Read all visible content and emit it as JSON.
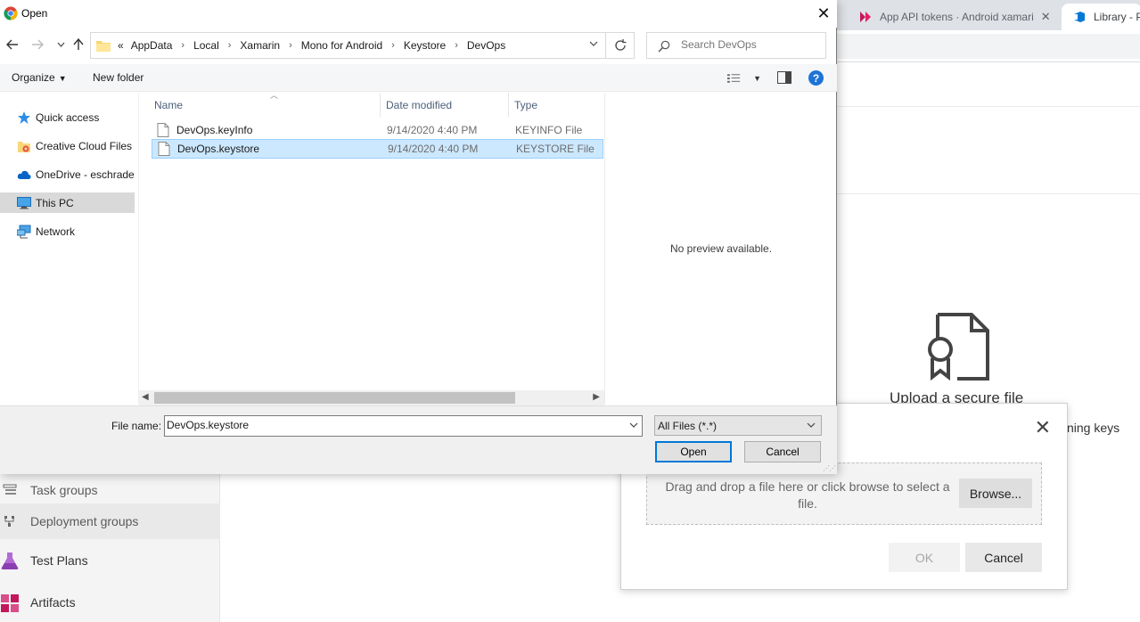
{
  "background": {
    "tabs": [
      {
        "label": "App API tokens · Android xamari"
      },
      {
        "label": "Library - P"
      }
    ],
    "sidebar": {
      "items": [
        {
          "label": "Task groups"
        },
        {
          "label": "Deployment groups"
        },
        {
          "label": "Test Plans"
        },
        {
          "label": "Artifacts"
        }
      ]
    },
    "upload_title": "Upload a secure file",
    "signing_text": "ning keys",
    "modal": {
      "drop_text": "Drag and drop a file here or click browse to select a file.",
      "browse_label": "Browse...",
      "ok_label": "OK",
      "cancel_label": "Cancel"
    }
  },
  "dialog": {
    "title": "Open",
    "close_glyph": "✕",
    "address": {
      "overflow": "«",
      "crumbs": [
        "AppData",
        "Local",
        "Xamarin",
        "Mono for Android",
        "Keystore",
        "DevOps"
      ],
      "separator": "›"
    },
    "search": {
      "placeholder": "Search DevOps"
    },
    "toolbar": {
      "organize_label": "Organize",
      "new_folder_label": "New folder",
      "help_glyph": "?"
    },
    "nav": {
      "items": [
        {
          "label": "Quick access",
          "icon": "star-icon"
        },
        {
          "label": "Creative Cloud Files",
          "icon": "creative-cloud-folder-icon"
        },
        {
          "label": "OneDrive - eschrader",
          "icon": "cloud-icon"
        },
        {
          "label": "This PC",
          "icon": "computer-icon",
          "selected": true
        },
        {
          "label": "Network",
          "icon": "network-icon"
        }
      ]
    },
    "columns": {
      "name": "Name",
      "date": "Date modified",
      "type": "Type"
    },
    "files": [
      {
        "name": "DevOps.keyInfo",
        "date": "9/14/2020 4:40 PM",
        "type": "KEYINFO File",
        "selected": false
      },
      {
        "name": "DevOps.keystore",
        "date": "9/14/2020 4:40 PM",
        "type": "KEYSTORE File",
        "selected": true
      }
    ],
    "preview_text": "No preview available.",
    "file_name_label": "File name:",
    "file_name_value": "DevOps.keystore",
    "file_type_value": "All Files (*.*)",
    "open_label": "Open",
    "cancel_label": "Cancel"
  },
  "colors": {
    "selection_bg": "#cce8ff",
    "selection_border": "#99d1ff",
    "accent": "#0078d7"
  }
}
